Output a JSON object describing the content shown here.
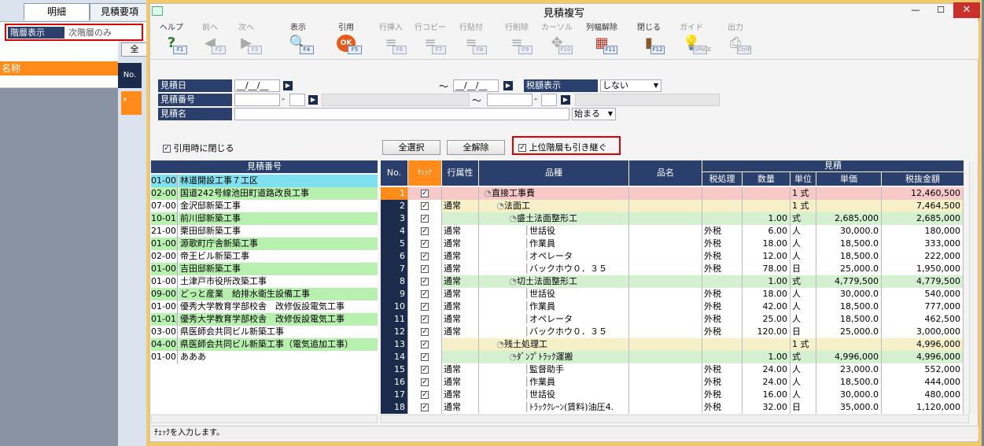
{
  "left": {
    "tabs": [
      "明細",
      "見積要項"
    ],
    "level_label": "階層表示",
    "level_value": "次階層のみ",
    "all_btn": "全",
    "name_header": "名称",
    "no_header": "No.",
    "star": "*"
  },
  "window": {
    "title": "見積複写",
    "min": "—",
    "max": "☐",
    "close": "✕"
  },
  "toolbar": [
    {
      "label": "ヘルプ",
      "key": "F1",
      "icon": "?",
      "enabled": true,
      "name": "help"
    },
    {
      "label": "前へ",
      "key": "F2",
      "icon": "◀",
      "enabled": false,
      "name": "prev"
    },
    {
      "label": "次へ",
      "key": "F3",
      "icon": "▶",
      "enabled": false,
      "name": "next"
    },
    {
      "label": "表示",
      "key": "F4",
      "icon": "🔍",
      "enabled": true,
      "name": "view"
    },
    {
      "label": "引用",
      "key": "F5",
      "icon": "OK",
      "enabled": true,
      "name": "quote"
    },
    {
      "label": "行挿入",
      "key": "F6",
      "icon": "≡",
      "enabled": false,
      "name": "row-insert"
    },
    {
      "label": "行コピー",
      "key": "F7",
      "icon": "≡",
      "enabled": false,
      "name": "row-copy"
    },
    {
      "label": "行貼付",
      "key": "F8",
      "icon": "≡",
      "enabled": false,
      "name": "row-paste"
    },
    {
      "label": "行削除",
      "key": "F9",
      "icon": "≡",
      "enabled": false,
      "name": "row-delete"
    },
    {
      "label": "カーソル",
      "key": "F10",
      "icon": "✥",
      "enabled": false,
      "name": "cursor"
    },
    {
      "label": "列幅解除",
      "key": "F11",
      "icon": "▦",
      "enabled": true,
      "name": "col-width-reset"
    },
    {
      "label": "閉じる",
      "key": "F12",
      "icon": "▮",
      "enabled": true,
      "name": "close"
    },
    {
      "label": "ガイド",
      "key": "SPACE",
      "icon": "💡",
      "enabled": false,
      "name": "guide"
    },
    {
      "label": "出力",
      "key": "CtrlP",
      "icon": "⎙",
      "enabled": false,
      "name": "output"
    }
  ],
  "form": {
    "date_label": "見積日",
    "date_from": "__/__/__",
    "tilde": "～",
    "date_to": "__/__/__",
    "tax_label": "税額表示",
    "tax_value": "しない",
    "no_label": "見積番号",
    "dash": "-",
    "name_label": "見積名",
    "match_value": "始まる",
    "close_on_quote": "引用時に閉じる",
    "select_all": "全選択",
    "deselect_all": "全解除",
    "inherit_parent": "上位階層も引き継ぐ"
  },
  "left_list": {
    "header": "見積番号",
    "rows": [
      {
        "code": "01-00",
        "name": "林道開設工事７工区",
        "color": "#7fe0f0"
      },
      {
        "code": "02-00",
        "name": "国道242号線池田町道路改良工事",
        "color": "#b8f0b0"
      },
      {
        "code": "07-00",
        "name": "金沢邸新築工事",
        "color": "#ffffff"
      },
      {
        "code": "10-01",
        "name": "前川邸新築工事",
        "color": "#b8f0b0"
      },
      {
        "code": "21-00",
        "name": "栗田邸新築工事",
        "color": "#ffffff"
      },
      {
        "code": "01-00",
        "name": "源歌町庁舎新築工事",
        "color": "#b8f0b0"
      },
      {
        "code": "02-00",
        "name": "帝王ビル新築工事",
        "color": "#ffffff"
      },
      {
        "code": "01-00",
        "name": "吉田邸新築工事",
        "color": "#b8f0b0"
      },
      {
        "code": "01-00",
        "name": "土津戸市役所改築工事",
        "color": "#ffffff"
      },
      {
        "code": "09-00",
        "name": "どっと産業　給排水衛生設備工事",
        "color": "#b8f0b0"
      },
      {
        "code": "01-00",
        "name": "優秀大学教育学部校舎　改修仮設電気工事",
        "color": "#ffffff"
      },
      {
        "code": "01-01",
        "name": "優秀大学教育学部校舎　改修仮設電気工事",
        "color": "#b8f0b0"
      },
      {
        "code": "03-00",
        "name": "県医師会共同ビル新築工事",
        "color": "#ffffff"
      },
      {
        "code": "04-00",
        "name": "県医師会共同ビル新築工事（電気追加工事）",
        "color": "#b8f0b0"
      },
      {
        "code": "01-00",
        "name": "あああ",
        "color": "#ffffff"
      }
    ]
  },
  "right_grid": {
    "headers": {
      "no": "No.",
      "check": "ﾁｪｯｸ",
      "attr": "行属性",
      "item": "品種",
      "spec": "品名",
      "group": "見積",
      "tax": "税処理",
      "qty": "数量",
      "unit": "単位",
      "price": "単価",
      "amount": "税抜金額"
    },
    "rows": [
      {
        "no": "1",
        "attr": "",
        "item": "直接工事費",
        "indent": 1,
        "tax": "",
        "qty": "",
        "unit": "1 式",
        "price": "",
        "amount": "12,460,500",
        "color": "#f7c9c9"
      },
      {
        "no": "2",
        "attr": "通常",
        "item": "法面工",
        "indent": 2,
        "tax": "",
        "qty": "",
        "unit": "1 式",
        "price": "",
        "amount": "7,464,500",
        "color": "#f5f0c8"
      },
      {
        "no": "3",
        "attr": "",
        "item": "盛土法面整形工",
        "indent": 3,
        "tax": "",
        "qty": "1.00",
        "unit": "式",
        "price": "2,685,000",
        "amount": "2,685,000",
        "color": "#d4f0d0"
      },
      {
        "no": "4",
        "attr": "通常",
        "item": "世話役",
        "indent": 4,
        "tax": "外税",
        "qty": "6.00",
        "unit": "人",
        "price": "30,000.0",
        "amount": "180,000",
        "color": "#ffffff"
      },
      {
        "no": "5",
        "attr": "通常",
        "item": "作業員",
        "indent": 4,
        "tax": "外税",
        "qty": "18.00",
        "unit": "人",
        "price": "18,500.0",
        "amount": "333,000",
        "color": "#ffffff"
      },
      {
        "no": "6",
        "attr": "通常",
        "item": "オペレータ",
        "indent": 4,
        "tax": "外税",
        "qty": "12.00",
        "unit": "人",
        "price": "18,500.0",
        "amount": "222,000",
        "color": "#ffffff"
      },
      {
        "no": "7",
        "attr": "通常",
        "item": "バックホウ０．３５",
        "indent": 4,
        "tax": "外税",
        "qty": "78.00",
        "unit": "日",
        "price": "25,000.0",
        "amount": "1,950,000",
        "color": "#ffffff"
      },
      {
        "no": "8",
        "attr": "通常",
        "item": "切土法面整形工",
        "indent": 3,
        "tax": "",
        "qty": "1.00",
        "unit": "式",
        "price": "4,779,500",
        "amount": "4,779,500",
        "color": "#d4f0d0"
      },
      {
        "no": "9",
        "attr": "通常",
        "item": "世話役",
        "indent": 4,
        "tax": "外税",
        "qty": "18.00",
        "unit": "人",
        "price": "30,000.0",
        "amount": "540,000",
        "color": "#ffffff"
      },
      {
        "no": "10",
        "attr": "通常",
        "item": "作業員",
        "indent": 4,
        "tax": "外税",
        "qty": "42.00",
        "unit": "人",
        "price": "18,500.0",
        "amount": "777,000",
        "color": "#ffffff"
      },
      {
        "no": "11",
        "attr": "通常",
        "item": "オペレータ",
        "indent": 4,
        "tax": "外税",
        "qty": "25.00",
        "unit": "人",
        "price": "18,500.0",
        "amount": "462,500",
        "color": "#ffffff"
      },
      {
        "no": "12",
        "attr": "通常",
        "item": "バックホウ０．３５",
        "indent": 4,
        "tax": "外税",
        "qty": "120.00",
        "unit": "日",
        "price": "25,000.0",
        "amount": "3,000,000",
        "color": "#ffffff"
      },
      {
        "no": "13",
        "attr": "",
        "item": "残土処理工",
        "indent": 2,
        "tax": "",
        "qty": "",
        "unit": "1 式",
        "price": "",
        "amount": "4,996,000",
        "color": "#f5f0c8"
      },
      {
        "no": "14",
        "attr": "",
        "item": "ﾀﾞﾝﾌﾟﾄﾗｯｸ運搬",
        "indent": 3,
        "tax": "",
        "qty": "1.00",
        "unit": "式",
        "price": "4,996,000",
        "amount": "4,996,000",
        "color": "#d4f0d0"
      },
      {
        "no": "15",
        "attr": "通常",
        "item": "監督助手",
        "indent": 4,
        "tax": "外税",
        "qty": "24.00",
        "unit": "人",
        "price": "23,000.0",
        "amount": "552,000",
        "color": "#ffffff"
      },
      {
        "no": "16",
        "attr": "通常",
        "item": "作業員",
        "indent": 4,
        "tax": "外税",
        "qty": "24.00",
        "unit": "人",
        "price": "18,500.0",
        "amount": "444,000",
        "color": "#ffffff"
      },
      {
        "no": "17",
        "attr": "通常",
        "item": "世話役",
        "indent": 4,
        "tax": "外税",
        "qty": "16.00",
        "unit": "人",
        "price": "30,000.0",
        "amount": "480,000",
        "color": "#ffffff"
      },
      {
        "no": "18",
        "attr": "通常",
        "item": "ﾄﾗｯｸｸﾚｰﾝ(賃料)油圧4.",
        "indent": 4,
        "tax": "外税",
        "qty": "32.00",
        "unit": "日",
        "price": "35,000.0",
        "amount": "1,120,000",
        "color": "#ffffff"
      }
    ]
  },
  "status": "ﾁｪｯｸを入力します。"
}
